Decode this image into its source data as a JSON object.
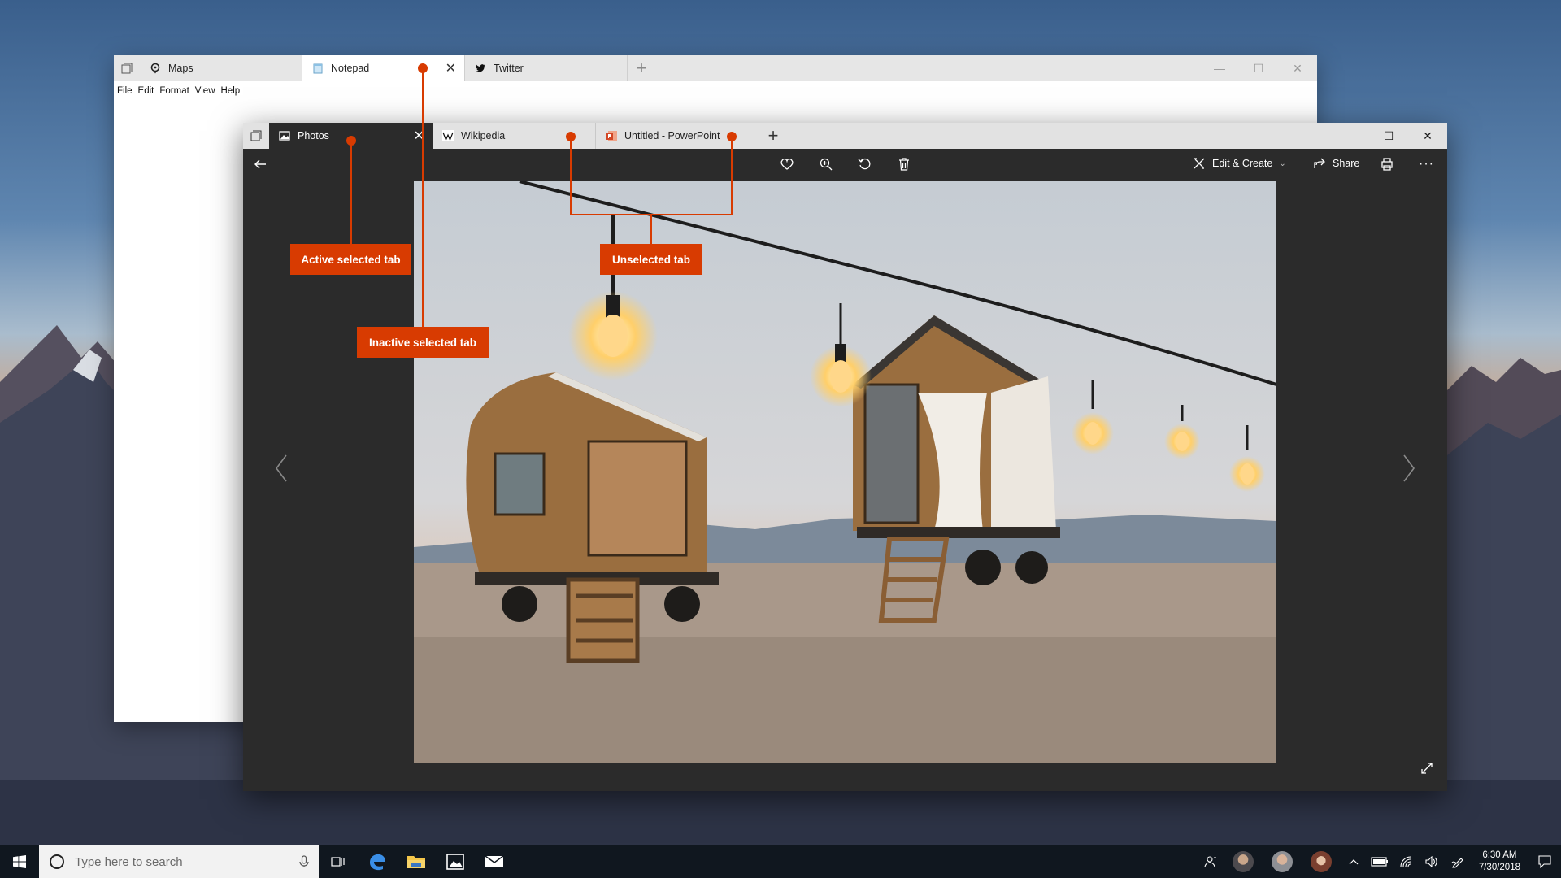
{
  "back_window": {
    "tabs": [
      {
        "label": "Maps",
        "icon": "map-pin-icon"
      },
      {
        "label": "Notepad",
        "icon": "notepad-icon",
        "selected": true
      },
      {
        "label": "Twitter",
        "icon": "twitter-icon"
      }
    ],
    "menu": [
      "File",
      "Edit",
      "Format",
      "View",
      "Help"
    ]
  },
  "front_window": {
    "tabs": [
      {
        "label": "Photos",
        "icon": "photos-icon",
        "selected": true
      },
      {
        "label": "Wikipedia",
        "icon": "wikipedia-icon"
      },
      {
        "label": "Untitled - PowerPoint",
        "icon": "powerpoint-icon"
      }
    ],
    "toolbar": {
      "edit_create": "Edit & Create",
      "share": "Share"
    }
  },
  "callouts": {
    "active_selected": "Active selected tab",
    "inactive_selected": "Inactive selected tab",
    "unselected": "Unselected tab"
  },
  "taskbar": {
    "search_placeholder": "Type here to search",
    "time": "6:30 AM",
    "date": "7/30/2018"
  },
  "colors": {
    "accent": "#d83b01",
    "taskbar": "#10171f",
    "photos_chrome": "#2b2b2b"
  }
}
